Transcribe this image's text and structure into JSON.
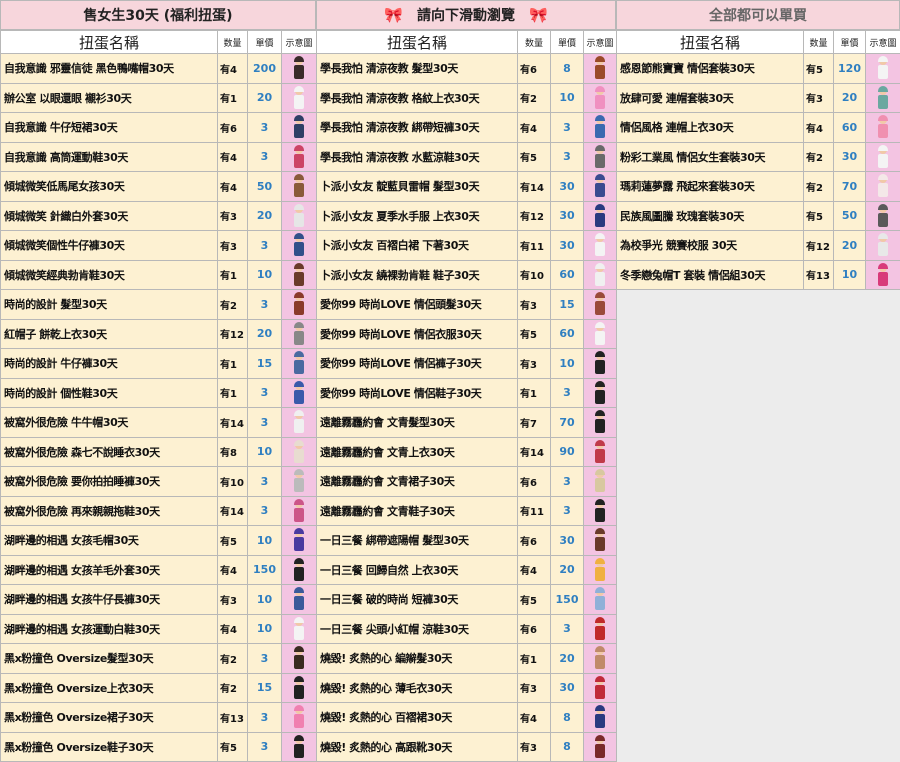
{
  "headers": {
    "left": "售女生30天 (福利扭蛋)",
    "middle": "請向下滑動瀏覽",
    "right": "全部都可以單買",
    "bow_icon": "🎀"
  },
  "columns": {
    "name": "扭蛋名稱",
    "qty": "数量",
    "price": "單價",
    "image": "示意圖"
  },
  "tables": [
    {
      "rows": [
        {
          "name": "自我意識 邪靈信徒 黑色鴨嘴帽30天",
          "qty": "有4",
          "price": "200",
          "color": "#3a2a2a"
        },
        {
          "name": "辦公室 以眼還眼 襯衫30天",
          "qty": "有1",
          "price": "20",
          "color": "#f4f4f4"
        },
        {
          "name": "自我意識  牛仔短裙30天",
          "qty": "有6",
          "price": "3",
          "color": "#2f3f66"
        },
        {
          "name": "自我意識  高筒運動鞋30天",
          "qty": "有4",
          "price": "3",
          "color": "#cc4466"
        },
        {
          "name": "傾城微笑低馬尾女孩30天",
          "qty": "有4",
          "price": "50",
          "color": "#8a5a3a"
        },
        {
          "name": "傾城微笑 針織白外套30天",
          "qty": "有3",
          "price": "20",
          "color": "#e6e6e6"
        },
        {
          "name": "傾城微笑個性牛仔褲30天",
          "qty": "有3",
          "price": "3",
          "color": "#32508a"
        },
        {
          "name": "傾城微笑經典勃肯鞋30天",
          "qty": "有1",
          "price": "10",
          "color": "#6a3a2a"
        },
        {
          "name": "時尚的設計  髮型30天",
          "qty": "有2",
          "price": "3",
          "color": "#8a3a2a"
        },
        {
          "name": "紅帽子 餅乾上衣30天",
          "qty": "有12",
          "price": "20",
          "color": "#888888"
        },
        {
          "name": "時尚的設計  牛仔褲30天",
          "qty": "有1",
          "price": "15",
          "color": "#4a6aa0"
        },
        {
          "name": "時尚的設計 個性鞋30天",
          "qty": "有1",
          "price": "3",
          "color": "#3a5aaa"
        },
        {
          "name": "被窩外很危險 牛牛帽30天",
          "qty": "有14",
          "price": "3",
          "color": "#f0f0f0"
        },
        {
          "name": "被窩外很危險 森七不說睡衣30天",
          "qty": "有8",
          "price": "10",
          "color": "#e8dcd0"
        },
        {
          "name": "被窩外很危險 要你拍拍睡褲30天",
          "qty": "有10",
          "price": "3",
          "color": "#bbbbbb"
        },
        {
          "name": "被窩外很危險 再來親親拖鞋30天",
          "qty": "有14",
          "price": "3",
          "color": "#cc5588"
        },
        {
          "name": "湖畔邊的相遇 女孩毛帽30天",
          "qty": "有5",
          "price": "10",
          "color": "#4a3aa0"
        },
        {
          "name": "湖畔邊的相遇 女孩羊毛外套30天",
          "qty": "有4",
          "price": "150",
          "color": "#222222"
        },
        {
          "name": "湖畔邊的相遇 女孩牛仔長褲30天",
          "qty": "有3",
          "price": "10",
          "color": "#3a5a9a"
        },
        {
          "name": "湖畔邊的相遇 女孩運動白鞋30天",
          "qty": "有4",
          "price": "10",
          "color": "#f4f4f4"
        },
        {
          "name": "黑x粉撞色 Oversize髮型30天",
          "qty": "有2",
          "price": "3",
          "color": "#3a2a20"
        },
        {
          "name": "黑x粉撞色 Oversize上衣30天",
          "qty": "有2",
          "price": "15",
          "color": "#222222"
        },
        {
          "name": "黑x粉撞色 Oversize裙子30天",
          "qty": "有13",
          "price": "3",
          "color": "#f080b0"
        },
        {
          "name": "黑x粉撞色 Oversize鞋子30天",
          "qty": "有5",
          "price": "3",
          "color": "#222222"
        }
      ]
    },
    {
      "rows": [
        {
          "name": "學長我怕 清涼夜教 髮型30天",
          "qty": "有6",
          "price": "8",
          "color": "#9a4a2a"
        },
        {
          "name": "學長我怕 清涼夜教 格紋上衣30天",
          "qty": "有2",
          "price": "10",
          "color": "#f090c0"
        },
        {
          "name": "學長我怕 清涼夜教 綁帶短褲30天",
          "qty": "有4",
          "price": "3",
          "color": "#3a6ab0"
        },
        {
          "name": "學長我怕 清涼夜教 水藍涼鞋30天",
          "qty": "有5",
          "price": "3",
          "color": "#6a6a6a"
        },
        {
          "name": "卜派小女友 靛藍貝雷帽 髮型30天",
          "qty": "有14",
          "price": "30",
          "color": "#3a4a90"
        },
        {
          "name": "卜派小女友 夏季水手服 上衣30天",
          "qty": "有12",
          "price": "30",
          "color": "#2a3a80"
        },
        {
          "name": "卜派小女友 百褶白裙 下著30天",
          "qty": "有11",
          "price": "30",
          "color": "#f4f4f4"
        },
        {
          "name": "卜派小女友 繞裸勃肯鞋 鞋子30天",
          "qty": "有10",
          "price": "60",
          "color": "#f0f0f0"
        },
        {
          "name": "愛你99 時尚LOVE 情侶頭髮30天",
          "qty": "有3",
          "price": "15",
          "color": "#9a4a3a"
        },
        {
          "name": "愛你99 時尚LOVE 情侶衣服30天",
          "qty": "有5",
          "price": "60",
          "color": "#f4f4f4"
        },
        {
          "name": "愛你99 時尚LOVE 情侶褲子30天",
          "qty": "有3",
          "price": "10",
          "color": "#222222"
        },
        {
          "name": "愛你99 時尚LOVE 情侶鞋子30天",
          "qty": "有1",
          "price": "3",
          "color": "#222222"
        },
        {
          "name": "遠離霧霾約會 文青髮型30天",
          "qty": "有7",
          "price": "70",
          "color": "#222222"
        },
        {
          "name": "遠離霧霾約會 文青上衣30天",
          "qty": "有14",
          "price": "90",
          "color": "#c03a4a"
        },
        {
          "name": "遠離霧霾約會 文青裙子30天",
          "qty": "有6",
          "price": "3",
          "color": "#d8c8a0"
        },
        {
          "name": "遠離霧霾約會 文青鞋子30天",
          "qty": "有11",
          "price": "3",
          "color": "#222222"
        },
        {
          "name": "一日三餐 綁帶遮陽帽 髮型30天",
          "qty": "有6",
          "price": "30",
          "color": "#6a3a2a"
        },
        {
          "name": "一日三餐 回歸自然 上衣30天",
          "qty": "有4",
          "price": "20",
          "color": "#f0b040"
        },
        {
          "name": "一日三餐 破的時尚 短褲30天",
          "qty": "有5",
          "price": "150",
          "color": "#90b0d8"
        },
        {
          "name": "一日三餐 尖頭小紅帽 涼鞋30天",
          "qty": "有6",
          "price": "3",
          "color": "#c02a2a"
        },
        {
          "name": "燒毀!  炙熱的心 編辮髮30天",
          "qty": "有1",
          "price": "20",
          "color": "#c08a6a"
        },
        {
          "name": "燒毀!  炙熱的心 薄毛衣30天",
          "qty": "有3",
          "price": "30",
          "color": "#c02a3a"
        },
        {
          "name": "燒毀!  炙熱的心 百褶裙30天",
          "qty": "有4",
          "price": "8",
          "color": "#2a3a80"
        },
        {
          "name": "燒毀!  炙熱的心 高跟靴30天",
          "qty": "有3",
          "price": "8",
          "color": "#7a2a2a"
        }
      ]
    },
    {
      "rows": [
        {
          "name": "感恩節熊寶寶 情侶套裝30天",
          "qty": "有5",
          "price": "120",
          "color": "#f4f4f4"
        },
        {
          "name": "放肆可愛 連帽套裝30天",
          "qty": "有3",
          "price": "20",
          "color": "#6aa8a0"
        },
        {
          "name": "情侶風格 連帽上衣30天",
          "qty": "有4",
          "price": "60",
          "color": "#f090b0"
        },
        {
          "name": "粉彩工業風 情侶女生套裝30天",
          "qty": "有2",
          "price": "30",
          "color": "#f4f4f4"
        },
        {
          "name": "瑪莉蓮夢露 飛起來套裝30天",
          "qty": "有2",
          "price": "70",
          "color": "#f4e8e8"
        },
        {
          "name": "民族風圖騰 玫瑰套裝30天",
          "qty": "有5",
          "price": "50",
          "color": "#5a5a5a"
        },
        {
          "name": "為校爭光 競賽校服 30天",
          "qty": "有12",
          "price": "20",
          "color": "#e8e8e8"
        },
        {
          "name": "冬季戀兔帽T 套裝 情侶組30天",
          "qty": "有13",
          "price": "10",
          "color": "#d83a7a"
        }
      ]
    }
  ]
}
